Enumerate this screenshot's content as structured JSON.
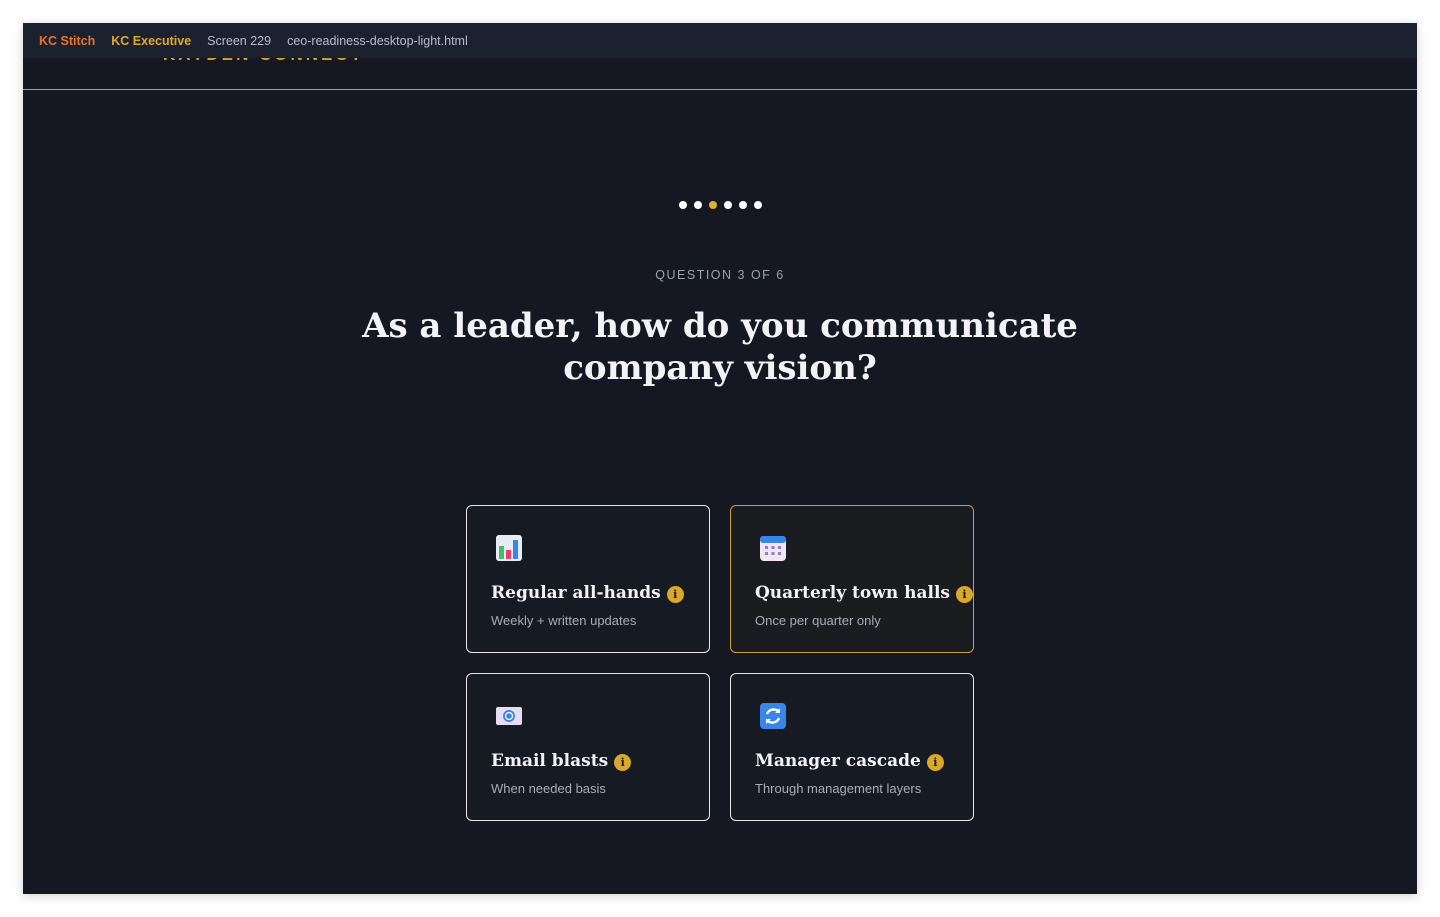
{
  "topbar": {
    "project": "KC Stitch",
    "workspace": "KC Executive",
    "screen": "Screen 229",
    "file": "ceo-readiness-desktop-light.html"
  },
  "brand": {
    "name": "KAYDEN CONNECT"
  },
  "progress": {
    "total_steps": 6,
    "current_step": 3
  },
  "question": {
    "counter": "QUESTION 3 OF 6",
    "title": "As a leader, how do you communicate company vision?"
  },
  "options": [
    {
      "title": "Regular all-hands",
      "subtitle": "Weekly + written updates",
      "icon": "bar-chart-icon",
      "info": "i",
      "selected": false
    },
    {
      "title": "Quarterly town halls",
      "subtitle": "Once per quarter only",
      "icon": "calendar-icon",
      "info": "i",
      "selected": true
    },
    {
      "title": "Email blasts",
      "subtitle": "When needed basis",
      "icon": "email-icon",
      "info": "i",
      "selected": false
    },
    {
      "title": "Manager cascade",
      "subtitle": "Through management layers",
      "icon": "refresh-icon",
      "info": "i",
      "selected": false
    }
  ],
  "colors": {
    "accent": "#d8a92a",
    "background": "#151823",
    "topbar": "#1c2130",
    "stitch": "#e8732e",
    "selected_border": "#c9a135"
  }
}
